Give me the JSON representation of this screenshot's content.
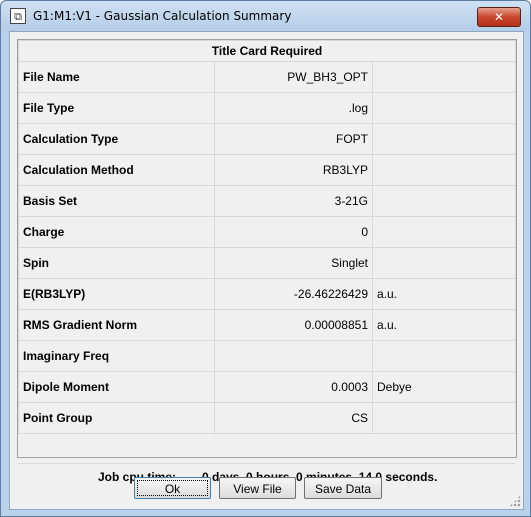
{
  "window": {
    "title": "G1:M1:V1 - Gaussian Calculation Summary",
    "close_glyph": "✕"
  },
  "header": "Title Card Required",
  "rows": [
    {
      "label": "File Name",
      "value": "PW_BH3_OPT",
      "unit": ""
    },
    {
      "label": "File Type",
      "value": ".log",
      "unit": ""
    },
    {
      "label": "Calculation Type",
      "value": "FOPT",
      "unit": ""
    },
    {
      "label": "Calculation Method",
      "value": "RB3LYP",
      "unit": ""
    },
    {
      "label": "Basis Set",
      "value": "3-21G",
      "unit": ""
    },
    {
      "label": "Charge",
      "value": "0",
      "unit": ""
    },
    {
      "label": "Spin",
      "value": "Singlet",
      "unit": ""
    },
    {
      "label": "E(RB3LYP)",
      "value": "-26.46226429",
      "unit": "a.u."
    },
    {
      "label": "RMS Gradient Norm",
      "value": "0.00008851",
      "unit": "a.u."
    },
    {
      "label": "Imaginary Freq",
      "value": "",
      "unit": ""
    },
    {
      "label": "Dipole Moment",
      "value": "0.0003",
      "unit": "Debye"
    },
    {
      "label": "Point Group",
      "value": "CS",
      "unit": ""
    }
  ],
  "footer": {
    "label": "Job cpu time:",
    "value": "0 days  0 hours  0 minutes  14.0 seconds."
  },
  "buttons": {
    "ok": "Ok",
    "view_file": "View File",
    "save_data": "Save Data"
  }
}
